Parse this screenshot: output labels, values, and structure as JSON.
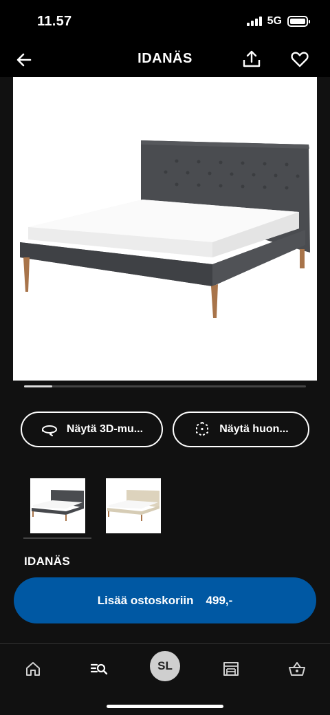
{
  "status_bar": {
    "time": "11.57",
    "network": "5G"
  },
  "nav": {
    "title": "IDANÄS",
    "back_icon": "arrow-left-icon",
    "share_icon": "share-icon",
    "favorite_icon": "heart-icon"
  },
  "gallery": {
    "progress": 0.1,
    "main_image": "dark-grey-upholstered-bed"
  },
  "actions": {
    "view_3d_label": "Näytä 3D-mu...",
    "view_room_label": "Näytä huon..."
  },
  "thumbnails": [
    {
      "name": "dark-grey-variant"
    },
    {
      "name": "beige-variant"
    }
  ],
  "product": {
    "name": "IDANÄS"
  },
  "cart": {
    "label": "Lisää ostoskoriin",
    "price": "499,-",
    "color": "#0058a3"
  },
  "tab_bar": {
    "home_icon": "home-icon",
    "search_icon": "search-list-icon",
    "profile_initials": "SL",
    "store_icon": "store-icon",
    "cart_icon": "basket-icon"
  }
}
